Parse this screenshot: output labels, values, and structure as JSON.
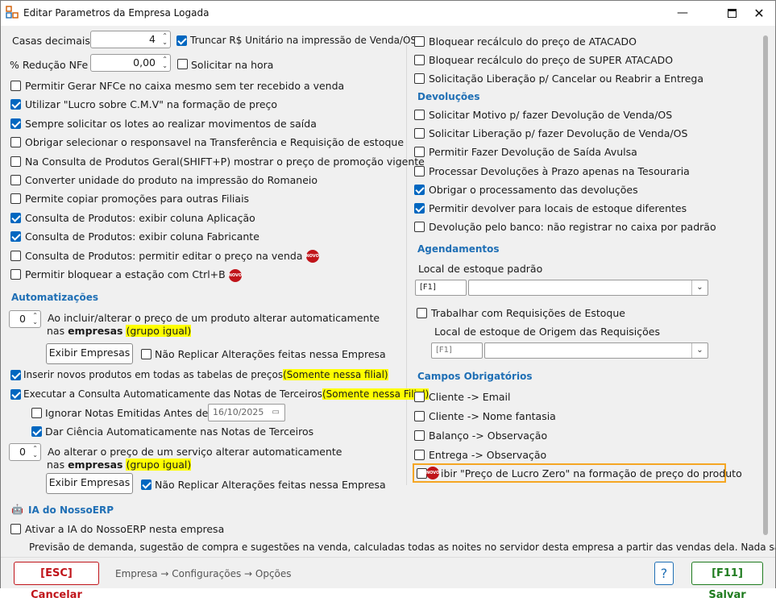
{
  "window": {
    "title": "Editar Parametros da Empresa Logada"
  },
  "top": {
    "casas_label": "Casas decimais",
    "casas_value": "4",
    "truncar_label": "Truncar R$ Unitário na impressão de Venda/OS",
    "reducao_label": "% Redução NFe",
    "reducao_value": "0,00",
    "solicitar_label": "Solicitar na hora"
  },
  "left_options": [
    {
      "label": "Permitir Gerar NFCe no caixa mesmo sem ter recebido a venda",
      "checked": false
    },
    {
      "label": "Utilizar \"Lucro sobre C.M.V\" na formação de preço",
      "checked": true
    },
    {
      "label": "Sempre solicitar os lotes ao realizar movimentos de saída",
      "checked": true
    },
    {
      "label": "Obrigar selecionar o responsavel na Transferência e Requisição de estoque",
      "checked": false
    },
    {
      "label": "Na Consulta de Produtos Geral(SHIFT+P) mostrar o preço de promoção vigente",
      "checked": false
    },
    {
      "label": "Converter unidade do produto na impressão do Romaneio",
      "checked": false
    },
    {
      "label": "Permite copiar promoções para outras Filiais",
      "checked": false
    },
    {
      "label": "Consulta de Produtos: exibir coluna Aplicação",
      "checked": true
    },
    {
      "label": "Consulta de Produtos: exibir coluna Fabricante",
      "checked": true
    },
    {
      "label": "Consulta de Produtos: permitir editar o preço na venda",
      "checked": false
    },
    {
      "label": "Permitir bloquear a estação com Ctrl+B",
      "checked": false
    }
  ],
  "badge": "NOVO",
  "auto": {
    "title": "Automatizações",
    "spin1_value": "0",
    "line1": "Ao incluir/alterar o preço de um produto alterar automaticamente",
    "nas": "nas ",
    "empresas": "empresas",
    "grupo": "(grupo igual)",
    "exibir_label": "Exibir Empresas",
    "nao_replicar_label": "Não Replicar Alterações feitas nessa Empresa",
    "inserir_label": "Inserir novos produtos em todas as tabelas de preços",
    "inserir_hl": "(Somente nessa filial)",
    "executar_label": "Executar a Consulta Automaticamente das Notas de Terceiros",
    "executar_hl": "(Somente nessa Filial)",
    "ignorar_label": "Ignorar Notas Emitidas Antes de:",
    "ignorar_date": "16/10/2025",
    "dar_label": "Dar Ciência Automaticamente nas Notas de Terceiros",
    "spin2_value": "0",
    "line2": "Ao alterar o preço de um serviço alterar automaticamente",
    "exibir2_label": "Exibir Empresas",
    "nao_replicar2_label": "Não Replicar Alterações feitas nessa Empresa"
  },
  "ia": {
    "title": "IA do NossoERP",
    "ativar_label": "Ativar a IA do NossoERP nesta empresa",
    "desc": "Previsão de demanda, sugestão de compra e sugestões na venda, calculadas todas as noites no servidor desta empresa a partir das vendas dela. Nada sai"
  },
  "right_top": [
    {
      "label": "Bloquear recálculo do preço de ATACADO",
      "checked": false
    },
    {
      "label": "Bloquear recálculo do preço de SUPER ATACADO",
      "checked": false
    },
    {
      "label": "Solicitação Liberação p/ Cancelar ou Reabrir a Entrega",
      "checked": false
    }
  ],
  "devolucoes": {
    "title": "Devoluções",
    "items": [
      {
        "label": "Solicitar Motivo p/ fazer Devolução de Venda/OS",
        "checked": false
      },
      {
        "label": "Solicitar Liberação p/ fazer Devolução de Venda/OS",
        "checked": false
      },
      {
        "label": "Permitir Fazer Devolução de Saída Avulsa",
        "checked": false
      },
      {
        "label": "Processar Devoluções à Prazo apenas na Tesouraria",
        "checked": false
      },
      {
        "label": "Obrigar o processamento das devoluções",
        "checked": true
      },
      {
        "label": "Permitir devolver para locais de estoque diferentes",
        "checked": true
      },
      {
        "label": "Devolução pelo banco: não registrar no caixa por padrão",
        "checked": false
      }
    ]
  },
  "agendamentos": {
    "title": "Agendamentos",
    "local_label": "Local de estoque padrão",
    "f1": "[F1]",
    "trabalhar_label": "Trabalhar com Requisições de Estoque",
    "origem_label": "Local de estoque de Origem das Requisições",
    "f1b": "[F1]"
  },
  "campos": {
    "title": "Campos Obrigatórios",
    "items": [
      {
        "label": "Cliente -> Email",
        "checked": false
      },
      {
        "label": "Cliente -> Nome fantasia",
        "checked": false
      },
      {
        "label": "Balanço -> Observação",
        "checked": false
      },
      {
        "label": "Entrega -> Observação",
        "checked": false
      }
    ],
    "exibir_lucro": "ibir \"Preço de Lucro Zero\" na formação de preço do produto"
  },
  "footer": {
    "cancel": "[ESC] Cancelar",
    "breadcrumb": "Empresa → Configurações → Opções",
    "help": "?",
    "save": "[F11] Salvar"
  },
  "colors": {
    "accent": "#0067c0",
    "section": "#1f6fb5",
    "highlight": "#ffff00",
    "cancel": "#c0141a",
    "save": "#1e7b1e",
    "focus": "#f5a623"
  }
}
